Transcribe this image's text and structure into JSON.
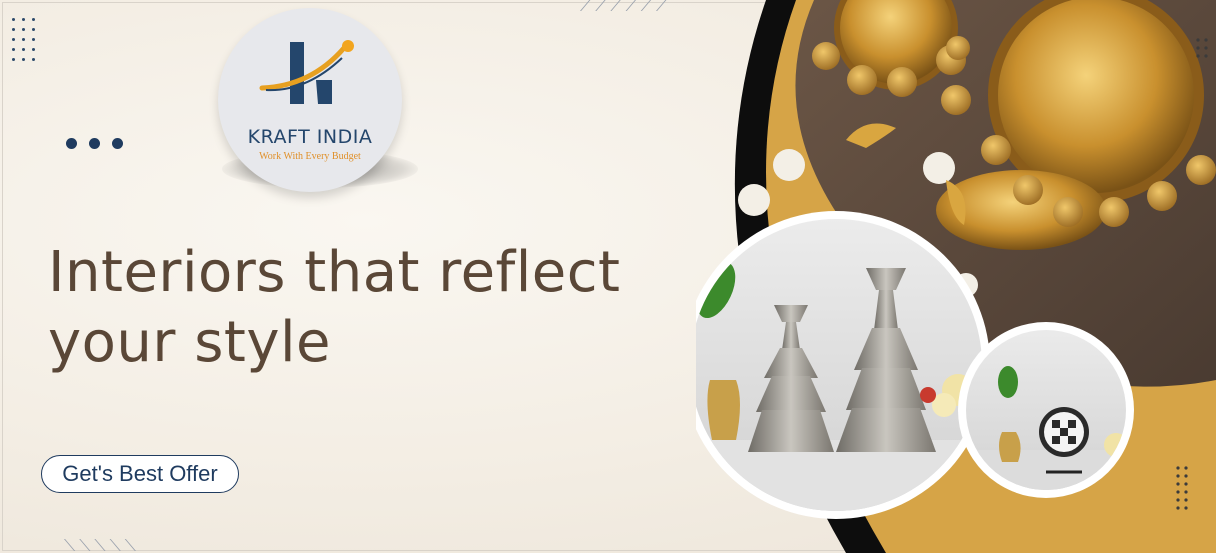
{
  "brand": {
    "name": "KRAFT INDIA",
    "tagline": "Work With Every Budget"
  },
  "hero": {
    "headline_line1": "Interiors that reflect",
    "headline_line2": "your style",
    "cta_label": "Get's Best Offer"
  },
  "colors": {
    "background": "#f3ede3",
    "headline": "#5a4737",
    "navy": "#1f3b5f",
    "accent_orange": "#e0902a",
    "gold": "#d6a447",
    "black": "#0d0d0d"
  },
  "icons": {
    "logo": "kraft-india-k-logo-icon",
    "pagination_dots": "three-dots-icon",
    "decor": "dot-grid-icon"
  }
}
